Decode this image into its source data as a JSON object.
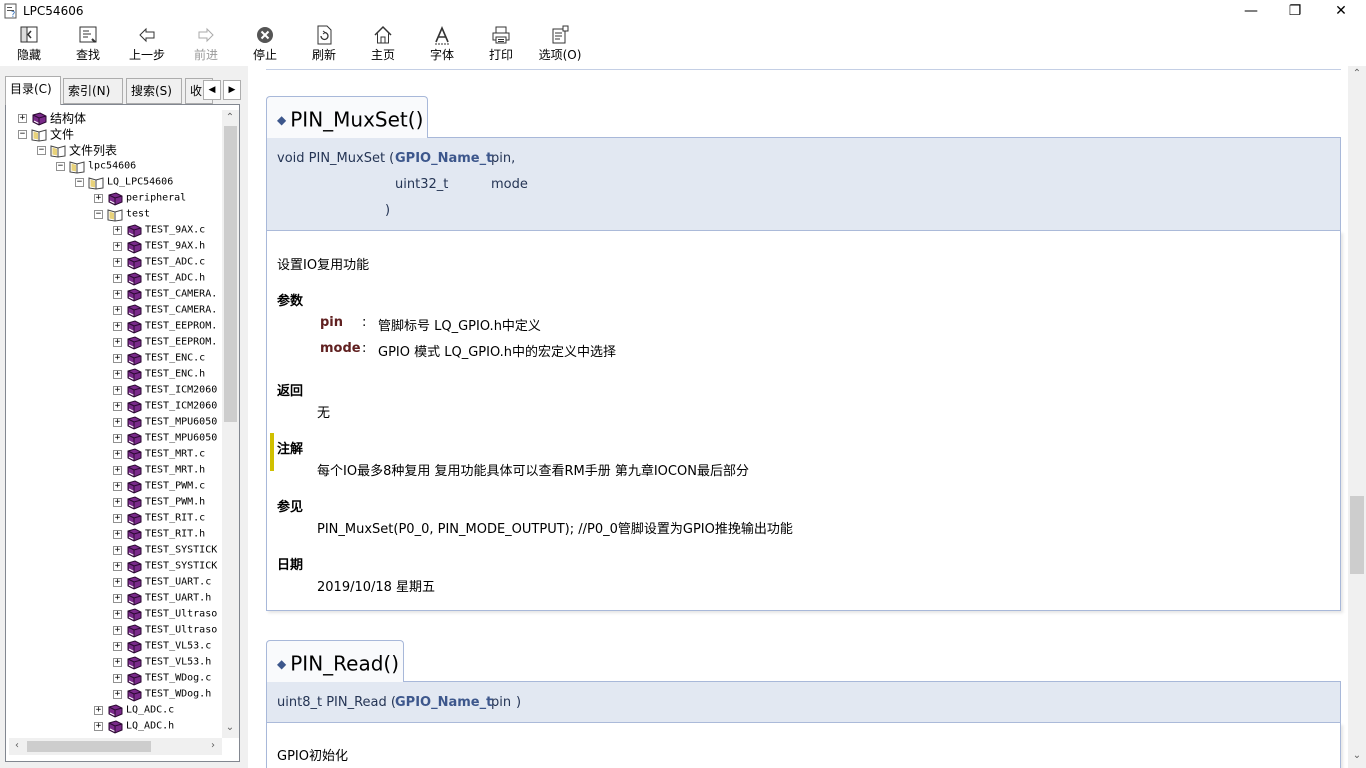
{
  "window": {
    "title": "LPC54606",
    "minimize": "—",
    "maximize": "❐",
    "close": "✕"
  },
  "toolbar": {
    "items": [
      {
        "label": "隐藏",
        "icon": "hide-icon",
        "enabled": true
      },
      {
        "label": "查找",
        "icon": "locate-icon",
        "enabled": true
      },
      {
        "label": "上一步",
        "icon": "back-arrow-icon",
        "enabled": true
      },
      {
        "label": "前进",
        "icon": "forward-arrow-icon",
        "enabled": false
      },
      {
        "label": "停止",
        "icon": "stop-icon",
        "enabled": true
      },
      {
        "label": "刷新",
        "icon": "refresh-icon",
        "enabled": true
      },
      {
        "label": "主页",
        "icon": "home-icon",
        "enabled": true
      },
      {
        "label": "字体",
        "icon": "font-icon",
        "enabled": true
      },
      {
        "label": "打印",
        "icon": "print-icon",
        "enabled": true
      },
      {
        "label": "选项(O)",
        "icon": "options-icon",
        "enabled": true
      }
    ]
  },
  "navtabs": {
    "contents": "目录(C)",
    "index": "索引(N)",
    "search": "搜索(S)",
    "favorites": "收",
    "arrow_left": "◀",
    "arrow_right": "▶"
  },
  "tree": {
    "nodes": [
      {
        "label": "结构体",
        "state": "+",
        "icon": "book-closed"
      },
      {
        "label": "文件",
        "state": "−",
        "icon": "book-open"
      },
      {
        "label": "文件列表",
        "state": "−",
        "icon": "book-open"
      },
      {
        "label": "lpc54606",
        "state": "−",
        "icon": "book-open"
      },
      {
        "label": "LQ_LPC54606",
        "state": "−",
        "icon": "book-open"
      },
      {
        "label": "peripheral",
        "state": "+",
        "icon": "book-closed"
      },
      {
        "label": "test",
        "state": "−",
        "icon": "book-open"
      },
      {
        "label": "TEST_9AX.c",
        "state": "+",
        "icon": "book-closed"
      },
      {
        "label": "TEST_9AX.h",
        "state": "+",
        "icon": "book-closed"
      },
      {
        "label": "TEST_ADC.c",
        "state": "+",
        "icon": "book-closed"
      },
      {
        "label": "TEST_ADC.h",
        "state": "+",
        "icon": "book-closed"
      },
      {
        "label": "TEST_CAMERA.",
        "state": "+",
        "icon": "book-closed"
      },
      {
        "label": "TEST_CAMERA.",
        "state": "+",
        "icon": "book-closed"
      },
      {
        "label": "TEST_EEPROM.",
        "state": "+",
        "icon": "book-closed"
      },
      {
        "label": "TEST_EEPROM.",
        "state": "+",
        "icon": "book-closed"
      },
      {
        "label": "TEST_ENC.c",
        "state": "+",
        "icon": "book-closed"
      },
      {
        "label": "TEST_ENC.h",
        "state": "+",
        "icon": "book-closed"
      },
      {
        "label": "TEST_ICM2060",
        "state": "+",
        "icon": "book-closed"
      },
      {
        "label": "TEST_ICM2060",
        "state": "+",
        "icon": "book-closed"
      },
      {
        "label": "TEST_MPU6050",
        "state": "+",
        "icon": "book-closed"
      },
      {
        "label": "TEST_MPU6050",
        "state": "+",
        "icon": "book-closed"
      },
      {
        "label": "TEST_MRT.c",
        "state": "+",
        "icon": "book-closed"
      },
      {
        "label": "TEST_MRT.h",
        "state": "+",
        "icon": "book-closed"
      },
      {
        "label": "TEST_PWM.c",
        "state": "+",
        "icon": "book-closed"
      },
      {
        "label": "TEST_PWM.h",
        "state": "+",
        "icon": "book-closed"
      },
      {
        "label": "TEST_RIT.c",
        "state": "+",
        "icon": "book-closed"
      },
      {
        "label": "TEST_RIT.h",
        "state": "+",
        "icon": "book-closed"
      },
      {
        "label": "TEST_SYSTICK",
        "state": "+",
        "icon": "book-closed"
      },
      {
        "label": "TEST_SYSTICK",
        "state": "+",
        "icon": "book-closed"
      },
      {
        "label": "TEST_UART.c",
        "state": "+",
        "icon": "book-closed"
      },
      {
        "label": "TEST_UART.h",
        "state": "+",
        "icon": "book-closed"
      },
      {
        "label": "TEST_Ultraso",
        "state": "+",
        "icon": "book-closed"
      },
      {
        "label": "TEST_Ultraso",
        "state": "+",
        "icon": "book-closed"
      },
      {
        "label": "TEST_VL53.c",
        "state": "+",
        "icon": "book-closed"
      },
      {
        "label": "TEST_VL53.h",
        "state": "+",
        "icon": "book-closed"
      },
      {
        "label": "TEST_WDog.c",
        "state": "+",
        "icon": "book-closed"
      },
      {
        "label": "TEST_WDog.h",
        "state": "+",
        "icon": "book-closed"
      },
      {
        "label": "LQ_ADC.c",
        "state": "+",
        "icon": "book-closed"
      },
      {
        "label": "LQ_ADC.h",
        "state": "+",
        "icon": "book-closed"
      }
    ]
  },
  "func1": {
    "name": "PIN_MuxSet()",
    "proto_prefix": "void PIN_MuxSet (",
    "param1_type": "GPIO_Name_t",
    "param1_name": "pin,",
    "param2_type": "uint32_t",
    "param2_name": "mode",
    "close_paren": ")",
    "brief": "设置IO复用功能",
    "params_heading": "参数",
    "params": [
      {
        "name": "pin",
        "sep": ":",
        "desc": "管脚标号 LQ_GPIO.h中定义"
      },
      {
        "name": "mode",
        "sep": ":",
        "desc": "GPIO 模式 LQ_GPIO.h中的宏定义中选择"
      }
    ],
    "return_heading": "返回",
    "return_value": "无",
    "note_heading": "注解",
    "note_text": "每个IO最多8种复用 复用功能具体可以查看RM手册 第九章IOCON最后部分",
    "see_heading": "参见",
    "see_text": "PIN_MuxSet(P0_0, PIN_MODE_OUTPUT); //P0_0管脚设置为GPIO推挽输出功能",
    "date_heading": "日期",
    "date_text": "2019/10/18 星期五"
  },
  "func2": {
    "name": "PIN_Read()",
    "proto_prefix": "uint8_t PIN_Read (",
    "param1_type": "GPIO_Name_t",
    "param1_name": "pin",
    "close_paren": ")",
    "brief": "GPIO初始化"
  },
  "colors": {
    "accent": "#3d578c",
    "proto_bg": "#e2e8f2",
    "border": "#a8b8d9",
    "param_name": "#602020",
    "note_bar": "#d0c000",
    "book": "#7a2a8a"
  }
}
